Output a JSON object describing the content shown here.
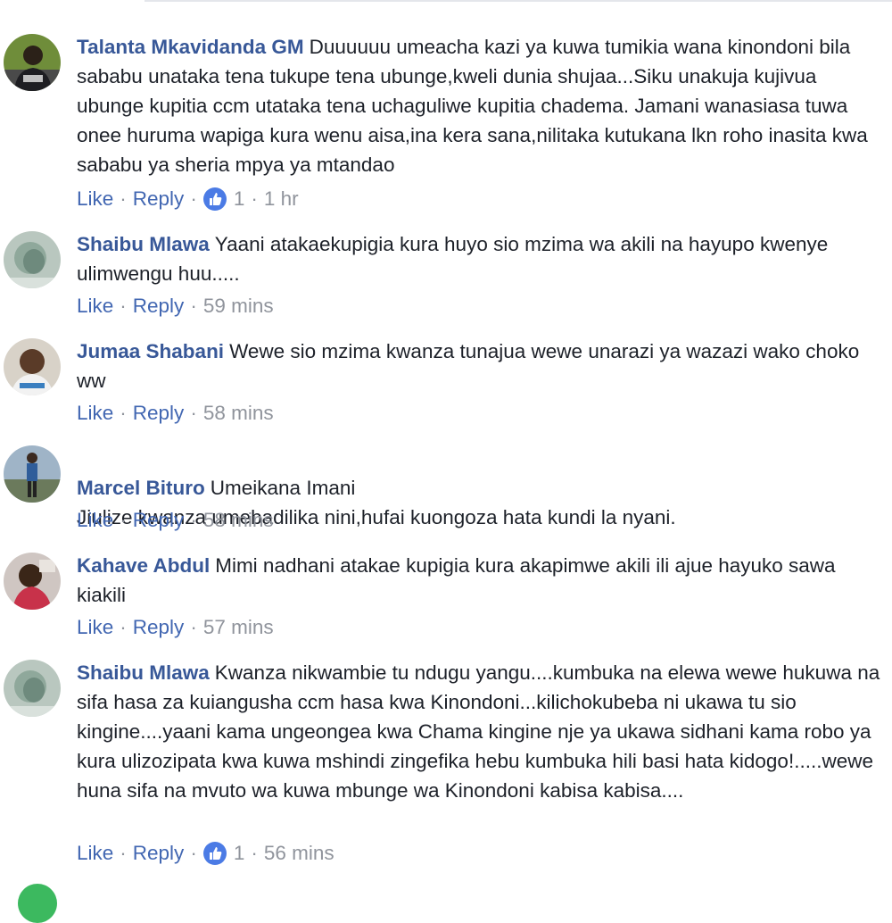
{
  "colors": {
    "author": "#385898",
    "link": "#4267b2",
    "meta": "#90949c",
    "like_badge": "#4b7be5",
    "text": "#1d2129"
  },
  "actions": {
    "like": "Like",
    "reply": "Reply",
    "dot": "·"
  },
  "comments": [
    {
      "author": "Talanta Mkavidanda GM",
      "text": "Duuuuuu umeacha kazi ya kuwa tumikia wana kinondoni bila sababu unataka tena tukupe tena ubunge,kweli dunia shujaa...Siku unakuja kujivua ubunge kupitia ccm utataka tena uchaguliwe kupitia chadema. Jamani wanasiasa tuwa onee huruma wapiga kura wenu aisa,ina kera sana,nilitaka kutukana lkn roho inasita kwa sababu ya sheria mpya ya mtandao",
      "likes": "1",
      "time": "1 hr",
      "avatar_icon": "profile-photo-man-dark"
    },
    {
      "author": "Shaibu Mlawa",
      "text": "Yaani atakaekupigia kura huyo sio mzima wa akili na hayupo kwenye ulimwengu huu.....",
      "likes": "",
      "time": "59 mins",
      "avatar_icon": "profile-photo-blurry"
    },
    {
      "author": "Jumaa Shabani",
      "text": "Wewe sio mzima kwanza tunajua wewe unarazi ya wazazi wako choko ww",
      "likes": "",
      "time": "58 mins",
      "avatar_icon": "profile-photo-man"
    },
    {
      "author": "Marcel Bituro",
      "text": "Umeikana Imani\nJiulize kwanza umebadilika nini,hufai kuongoza hata kundi la nyani.",
      "likes": "",
      "time": "58 mins",
      "avatar_icon": "profile-photo-standing"
    },
    {
      "author": "Kahave Abdul",
      "text": "Mimi nadhani atakae kupigia kura akapimwe akili ili ajue hayuko sawa kiakili",
      "likes": "",
      "time": "57 mins",
      "avatar_icon": "profile-photo-woman"
    },
    {
      "author": "Shaibu Mlawa",
      "text": "Kwanza nikwambie tu ndugu yangu....kumbuka na elewa wewe hukuwa na sifa hasa za kuiangusha ccm hasa kwa Kinondoni...kilichokubeba ni ukawa tu sio kingine....yaani kama ungeongea kwa Chama kingine nje ya ukawa sidhani kama robo ya kura ulizozipata kwa kuwa mshindi zingefika hebu kumbuka hili basi hata kidogo!.....wewe huna sifa na mvuto wa kuwa mbunge wa Kinondoni kabisa kabisa....",
      "likes": "1",
      "time": "56 mins",
      "avatar_icon": "profile-photo-blurry"
    }
  ]
}
